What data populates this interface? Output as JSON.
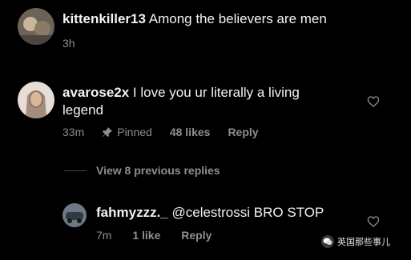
{
  "comments": [
    {
      "username": "kittenkiller13",
      "text": "Among the believers are men",
      "time": "3h"
    },
    {
      "username": "avarose2x",
      "text_line1": "I love you ur literally a living",
      "text_line2": "legend",
      "time": "33m",
      "pinned_label": "Pinned",
      "likes": "48 likes",
      "reply_label": "Reply"
    }
  ],
  "view_previous": "View 8 previous replies",
  "reply": {
    "username": "fahmyzzz._",
    "text": "@celestrossi BRO STOP",
    "time": "7m",
    "likes": "1 like",
    "reply_label": "Reply"
  },
  "watermark": "英国那些事儿",
  "icons": {
    "heart": "heart-outline-icon",
    "pin": "pin-icon",
    "watermark": "wechat-icon"
  }
}
